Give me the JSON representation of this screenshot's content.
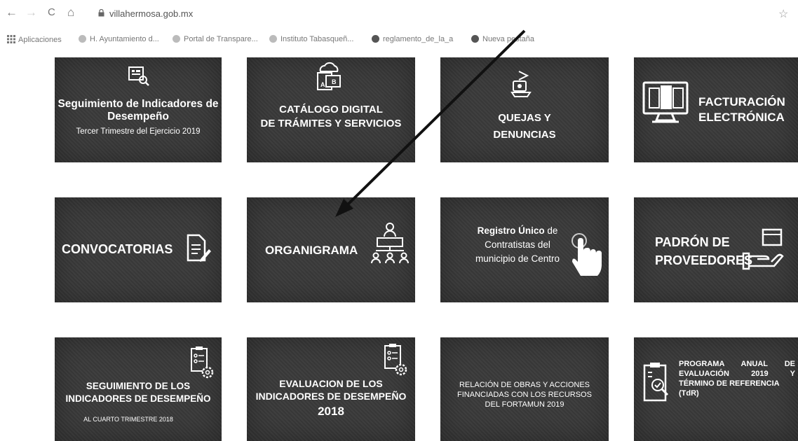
{
  "browser": {
    "back": "←",
    "forward": "→",
    "reload": "C",
    "home": "⌂",
    "url": "villahermosa.gob.mx",
    "star": "☆"
  },
  "bookmarks": [
    {
      "label": "Aplicaciones"
    },
    {
      "label": "H. Ayuntamiento d..."
    },
    {
      "label": "Portal de Transpare..."
    },
    {
      "label": "Instituto Tabasqueñ..."
    },
    {
      "label": "reglamento_de_la_a"
    },
    {
      "label": "Nueva pestaña"
    }
  ],
  "tiles": {
    "seguimiento": {
      "title": "Seguimiento de Indicadores de Desempeño",
      "subtitle": "Tercer Trimestre del Ejercicio 2019"
    },
    "catalogo": {
      "line1": "CATÁLOGO DIGITAL",
      "line2": "DE TRÁMITES Y SERVICIOS"
    },
    "quejas": {
      "line1": "QUEJAS Y",
      "line2": "DENUNCIAS"
    },
    "facturacion": {
      "line1": "FACTURACIÓN",
      "line2": "ELECTRÓNICA"
    },
    "convocatorias": {
      "label": "CONVOCATORIAS"
    },
    "organigrama": {
      "label": "ORGANIGRAMA"
    },
    "registro": {
      "bold": "Registro Único",
      "rest1": " de",
      "line2": "Contratistas del",
      "line3": "municipio de Centro"
    },
    "padron": {
      "line1": "PADRÓN DE",
      "line2": "PROVEEDORES"
    },
    "seg_los": {
      "line1": "SEGUIMIENTO DE LOS",
      "line2": "INDICADORES DE DESEMPEÑO",
      "line3": "AL CUARTO TRIMESTRE 2018"
    },
    "evaluacion": {
      "line1": "EVALUACION DE LOS",
      "line2": "INDICADORES DE DESEMPEÑO",
      "line3": "2018"
    },
    "relacion": {
      "line1": "RELACIÓN DE OBRAS Y ACCIONES",
      "line2": "FINANCIADAS CON LOS RECURSOS",
      "line3": "DEL FORTAMUN 2019"
    },
    "programa": {
      "line1": "PROGRAMA ANUAL DE",
      "line2": "EVALUACIÓN 2019 Y",
      "line3": "TÉRMINO DE REFERENCIA",
      "line4": "(TdR)"
    }
  },
  "colors": {
    "tile_bg": "#3a3a3a",
    "arrow": "#111111"
  }
}
